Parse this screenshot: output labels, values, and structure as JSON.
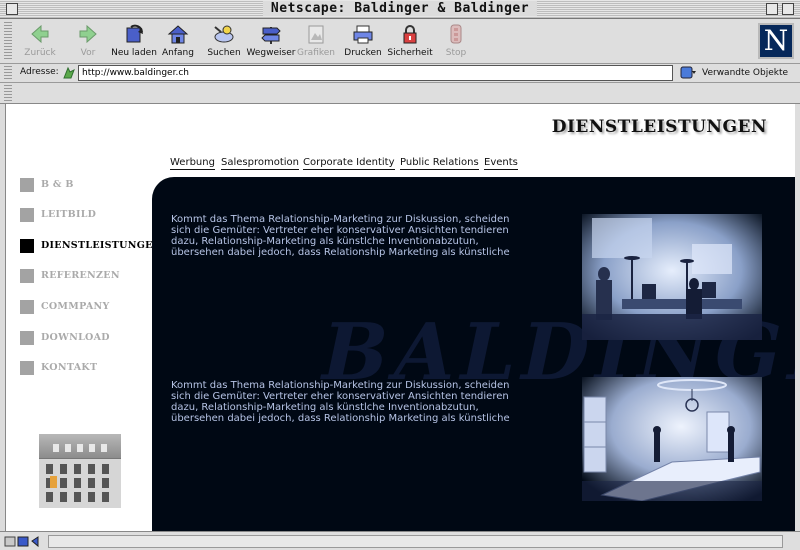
{
  "window": {
    "title": "Netscape:  Baldinger & Baldinger"
  },
  "toolbar": {
    "buttons": [
      {
        "label": "Zurück",
        "icon": "back-arrow-icon",
        "enabled": false
      },
      {
        "label": "Vor",
        "icon": "forward-arrow-icon",
        "enabled": false
      },
      {
        "label": "Neu laden",
        "icon": "reload-icon",
        "enabled": true
      },
      {
        "label": "Anfang",
        "icon": "home-icon",
        "enabled": true
      },
      {
        "label": "Suchen",
        "icon": "search-icon",
        "enabled": true
      },
      {
        "label": "Wegweiser",
        "icon": "guide-icon",
        "enabled": true
      },
      {
        "label": "Grafiken",
        "icon": "images-icon",
        "enabled": false
      },
      {
        "label": "Drucken",
        "icon": "print-icon",
        "enabled": true
      },
      {
        "label": "Sicherheit",
        "icon": "security-lock-icon",
        "enabled": true
      },
      {
        "label": "Stop",
        "icon": "stop-icon",
        "enabled": false
      }
    ],
    "logo": "N"
  },
  "location": {
    "label": "Adresse:",
    "url": "http://www.baldinger.ch",
    "related_label": "Verwandte Objekte"
  },
  "page": {
    "heading": "DIENSTLEISTUNGEN",
    "topnav": [
      "Werbung",
      "Salespromotion",
      "Corporate Identity",
      "Public Relations",
      "Events"
    ],
    "sidenav": [
      {
        "label": "B & B",
        "active": false
      },
      {
        "label": "LEITBILD",
        "active": false
      },
      {
        "label": "DIENSTLEISTUNGEN",
        "active": true
      },
      {
        "label": "REFERENZEN",
        "active": false
      },
      {
        "label": "COMMPANY",
        "active": false
      },
      {
        "label": "DOWNLOAD",
        "active": false
      },
      {
        "label": "KONTAKT",
        "active": false
      }
    ],
    "paragraphs": [
      "Kommt das Thema Relationship-Marketing zur Diskussion, scheiden sich die Gemüter: Vertreter eher konservativer Ansichten tendieren dazu, Relationship-Marketing als künstlche Inventionabzutun, übersehen dabei jedoch, dass Relationship Marketing als künstliche",
      "Kommt das Thema Relationship-Marketing zur Diskussion, scheiden sich die Gemüter: Vertreter eher konservativer Ansichten tendieren dazu, Relationship-Marketing als künstlche Inventionabzutun, übersehen dabei jedoch, dass Relationship Marketing als künstliche"
    ],
    "background_lettering": "BALDINGER"
  },
  "colors": {
    "panel": "#000814",
    "panel_text": "#b6c4e6",
    "chrome": "#dedede",
    "logo_bg": "#06285a"
  }
}
